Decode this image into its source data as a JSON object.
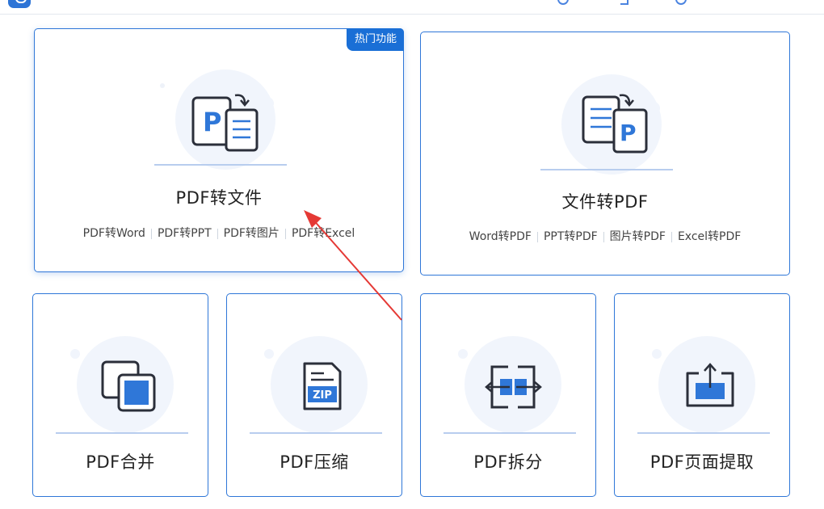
{
  "hot_badge": "热门功能",
  "cards": {
    "pdf_to_file": {
      "title": "PDF转文件",
      "links": [
        "PDF转Word",
        "PDF转PPT",
        "PDF转图片",
        "PDF转Excel"
      ]
    },
    "file_to_pdf": {
      "title": "文件转PDF",
      "links": [
        "Word转PDF",
        "PPT转PDF",
        "图片转PDF",
        "Excel转PDF"
      ]
    },
    "merge": {
      "title": "PDF合并"
    },
    "compress": {
      "title": "PDF压缩",
      "icon_label": "ZIP"
    },
    "split": {
      "title": "PDF拆分"
    },
    "extract": {
      "title": "PDF页面提取"
    }
  },
  "icons": {
    "pdf_to_file": "pdf-to-document-icon",
    "file_to_pdf": "document-to-pdf-icon",
    "merge": "merge-squares-icon",
    "compress": "zip-file-icon",
    "split": "split-arrows-icon",
    "extract": "extract-upload-icon",
    "letter_p": "P"
  },
  "colors": {
    "accent": "#2f77d8",
    "badge": "#1a6fd6",
    "icon_blue": "#2f77d8",
    "icon_stroke": "#2b2f3a",
    "annotation_arrow": "#e53935"
  }
}
